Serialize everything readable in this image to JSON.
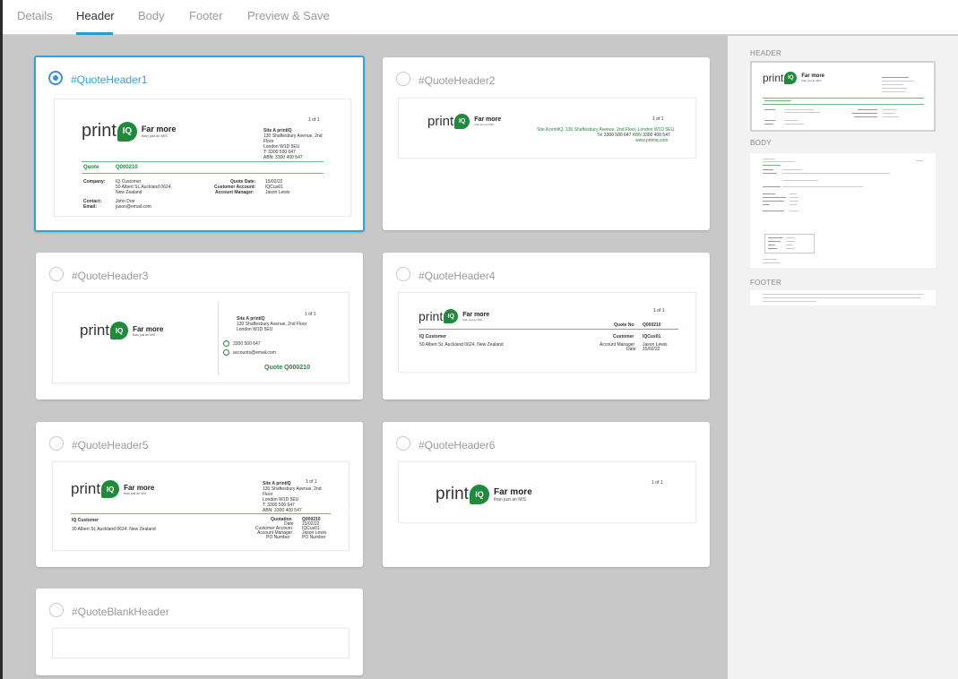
{
  "tabs": [
    {
      "label": "Details",
      "active": false
    },
    {
      "label": "Header",
      "active": true
    },
    {
      "label": "Body",
      "active": false
    },
    {
      "label": "Footer",
      "active": false
    },
    {
      "label": "Preview & Save",
      "active": false
    }
  ],
  "colors": {
    "accent": "#2ea3dc",
    "brand_green": "#1e8a3a",
    "canvas_bg": "#c8c8c8"
  },
  "logo": {
    "word": "print",
    "mark": "IQ",
    "tagline_big": "Far more",
    "tagline_small": "than just an MIS"
  },
  "cards": [
    {
      "title": "#QuoteHeader1",
      "selected": true,
      "page": "1 of 1",
      "site": "Site A printIQ",
      "address": [
        "130 Shaftesbury Avenue, 2nd",
        "Floor",
        "London W1D 5EU"
      ],
      "phone": "T: 3300 500 647",
      "abn": "ABN: 3300 400 547",
      "quote_label": "Quote",
      "quote_no": "Q000210",
      "company_label": "Company:",
      "company": [
        "IQ Customer",
        "50 Albert St, Auckland 0624,",
        "New Zealand"
      ],
      "quote_date_label": "Quote Date:",
      "quote_date": "15/02/22",
      "customer_account_label": "Customer Account:",
      "customer_account": "IQCus01",
      "account_manager_label": "Account Manager:",
      "account_manager": "Jason Lewis",
      "contact_label": "Contact:",
      "contact": "John Doe",
      "email_label": "Email:",
      "email": "jason@email.com"
    },
    {
      "title": "#QuoteHeader2",
      "selected": false,
      "page": "1 of 1",
      "line1": "Site A printIQ, 130 Shaftesbury Avenue, 2nd Floor, London W1D 5EU",
      "tel_label": "Tel",
      "tel": "3300 500 647",
      "abn_label": "ABN",
      "abn": "3300 400 547",
      "web": "www.printiq.com"
    },
    {
      "title": "#QuoteHeader3",
      "selected": false,
      "page": "1 of 1",
      "site": "Site A printIQ",
      "address": [
        "130 Shaftesbury Avenue, 2nd Floor",
        "London W1D 5EU"
      ],
      "phone": "3300 500 647",
      "email": "accounts@email.com",
      "quote": "Quote Q000210"
    },
    {
      "title": "#QuoteHeader4",
      "selected": false,
      "page": "1 of 1",
      "quote_no_label": "Quote No",
      "quote_no": "Q000210",
      "customer_name": "IQ Customer",
      "customer_address": "50 Albert St, Auckland 0624, New Zealand",
      "customer_label": "Customer",
      "customer": "IQCus01",
      "account_manager_label": "Account Manager",
      "account_manager": "Jason Lewis",
      "date_label": "Date",
      "date": "15/02/22"
    },
    {
      "title": "#QuoteHeader5",
      "selected": false,
      "page": "1 of 1",
      "site": "Site A printIQ",
      "address": [
        "130 Shaftesbury Avenue, 2nd",
        "Floor",
        "London W1D 5EU"
      ],
      "phone": "T: 3300 500 647",
      "abn": "ABN: 3300 400 547",
      "customer_name": "IQ Customer",
      "customer_address": "30 Albert St, Auckland 0624, New Zealand",
      "labels": [
        "Quotation",
        "Date",
        "Customer Account",
        "Account Manager",
        "PO Number"
      ],
      "values": [
        "Q000210",
        "15/02/22",
        "IQCus01",
        "Jason Lewis",
        "PO Number"
      ]
    },
    {
      "title": "#QuoteHeader6",
      "selected": false,
      "page": "1 of 1"
    },
    {
      "title": "#QuoteBlankHeader",
      "selected": false
    }
  ],
  "sidebar": {
    "header_label": "HEADER",
    "body_label": "BODY",
    "footer_label": "FOOTER"
  }
}
